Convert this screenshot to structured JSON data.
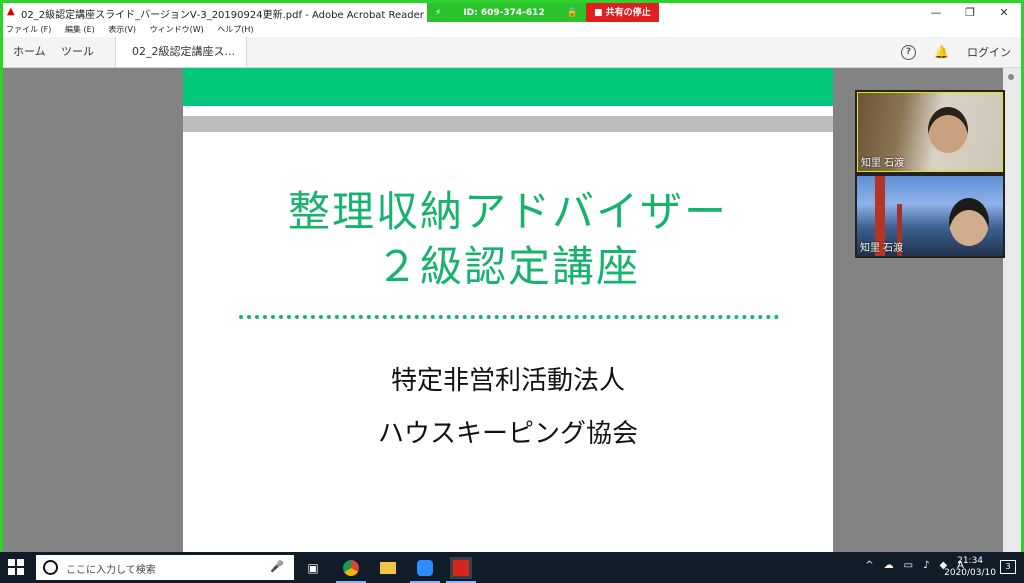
{
  "window": {
    "title": "02_2級認定講座スライド_バージョンⅤ-3_20190924更新.pdf - Adobe Acrobat Reader DC",
    "app_icon": "pdf-icon",
    "controls": [
      "—",
      "❐",
      "✕"
    ]
  },
  "share_bar": {
    "id_label": "ID: 609-374-612",
    "stop_label": "共有の停止",
    "accent": "#2bc32b",
    "stop_color": "#e02020"
  },
  "menu": [
    "ファイル (F)",
    "編集 (E)",
    "表示(V)",
    "ウィンドウ(W)",
    "ヘルプ(H)"
  ],
  "toolbar": {
    "tabs": [
      "ホーム",
      "ツール",
      "02_2級認定講座ス..."
    ],
    "close_glyph": "✕",
    "help_glyph": "?",
    "bell_glyph": "🔔",
    "login_label": "ログイン"
  },
  "slide": {
    "title_line1": "整理収納アドバイザー",
    "title_line2": "２級認定講座",
    "org_line1": "特定非営利活動法人",
    "org_line2": "ハウスキーピング協会",
    "accent": "#17b36e"
  },
  "video_tiles": [
    {
      "name": "知里 石渡"
    },
    {
      "name": "知里 石渡"
    }
  ],
  "taskbar": {
    "search_placeholder": "ここに入力して検索",
    "mic_glyph": "🎤",
    "tray_ime": "A",
    "time": "21:34",
    "date": "2020/03/10"
  }
}
